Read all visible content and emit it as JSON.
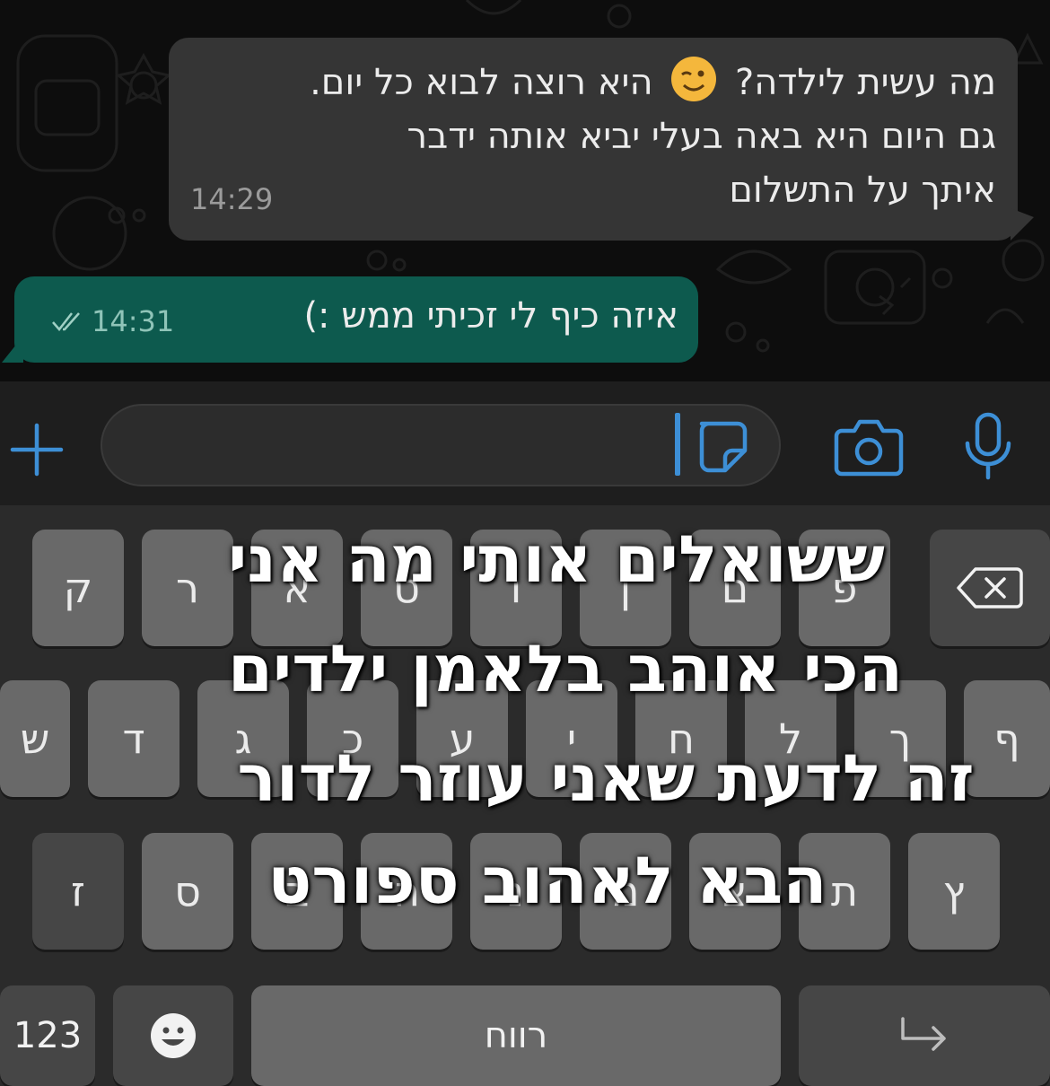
{
  "messages": [
    {
      "direction": "incoming",
      "text_before_emoji": "מה עשית לילדה?",
      "emoji": "winking-face",
      "text_after_emoji": "היא רוצה לבוא כל יום.",
      "line2": "גם היום היא באה בעלי יביא אותה ידבר",
      "line3": "איתך על התשלום",
      "time": "14:29"
    },
    {
      "direction": "outgoing",
      "text": "איזה כיף לי זכיתי ממש :)",
      "time": "14:31",
      "status": "read"
    }
  ],
  "input_bar": {
    "plus_icon": "plus-icon",
    "sticker_icon": "sticker-icon",
    "camera_icon": "camera-icon",
    "mic_icon": "microphone-icon",
    "accent_color": "#3d8fd6"
  },
  "keyboard": {
    "row1": [
      "ק",
      "ר",
      "א",
      "ט",
      "ו",
      "ן",
      "ם",
      "פ"
    ],
    "row2": [
      "ש",
      "ד",
      "ג",
      "כ",
      "ע",
      "י",
      "ח",
      "ל",
      "ך",
      "ף"
    ],
    "row3": [
      "ז",
      "ס",
      "ב",
      "ה",
      "נ",
      "מ",
      "צ",
      "ת",
      "ץ"
    ],
    "numbers_label": "123",
    "space_label": "רווח",
    "backspace_icon": "backspace-icon",
    "emoji_icon": "emoji-icon",
    "return_icon": "return-icon"
  },
  "caption": {
    "line1": "ששואלים אותי מה אני",
    "line2": "הכי אוהב בלאמן ילדים",
    "line3": "זה לדעת שאני עוזר לדור",
    "line4": "הבא לאהוב ספורט"
  }
}
